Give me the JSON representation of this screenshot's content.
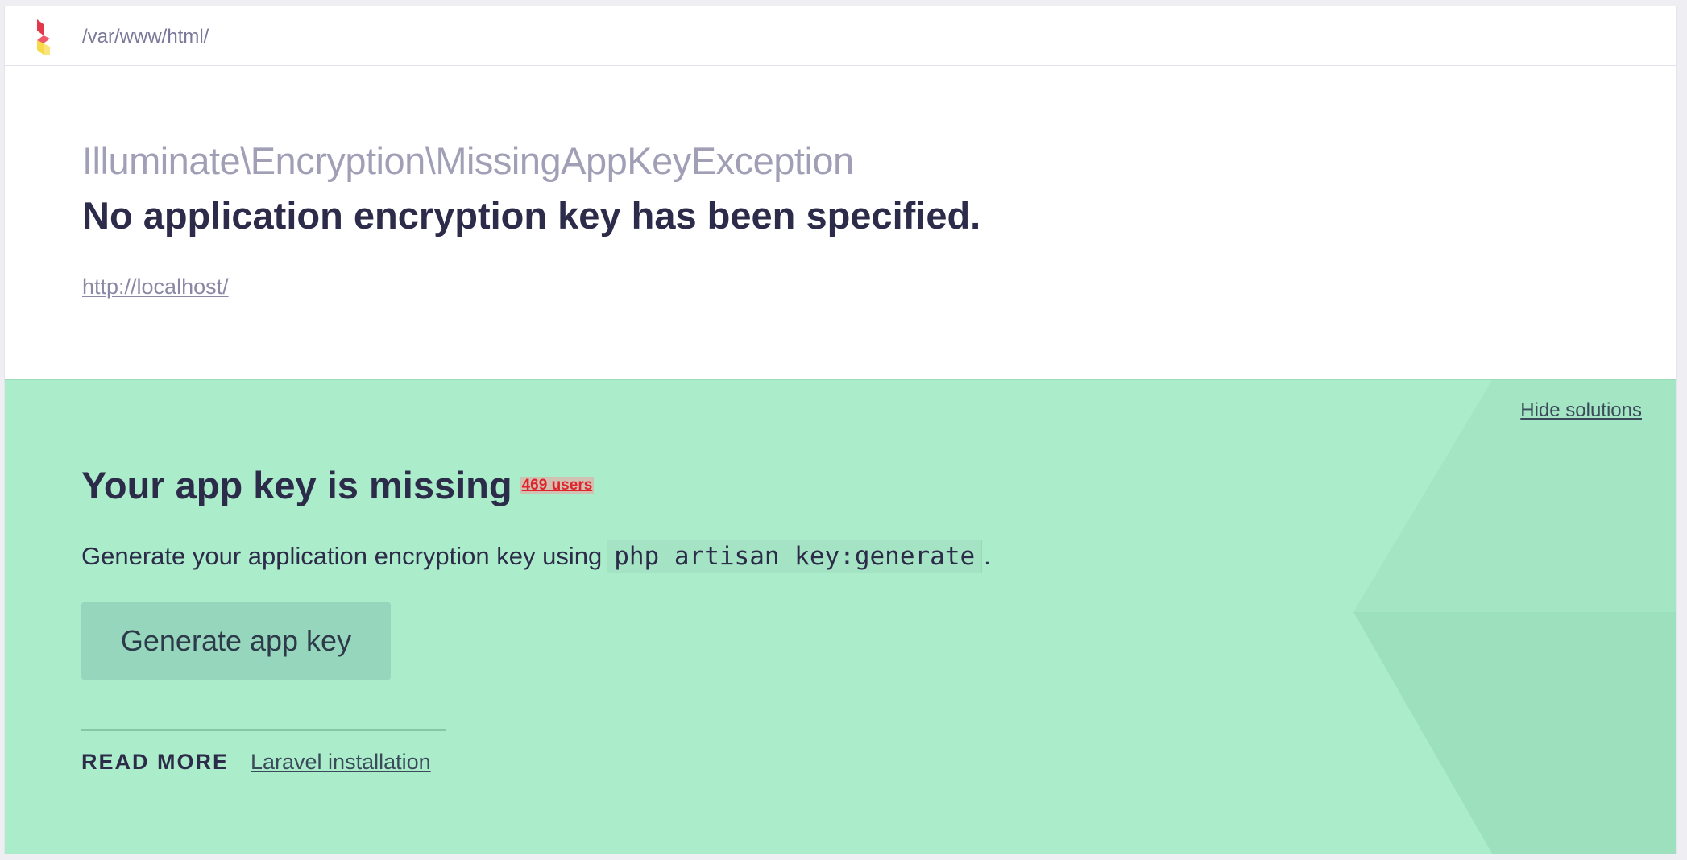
{
  "header": {
    "path": "/var/www/html/",
    "logo_icon": "flare-logo-icon"
  },
  "exception": {
    "class_prefix": "Illuminate\\Encryption\\",
    "class_name": "MissingAppKeyException",
    "message": "No application encryption key has been specified.",
    "url": "http://localhost/"
  },
  "solution": {
    "hide_label": "Hide solutions",
    "title": "Your app key is missing",
    "users_badge": "469 users",
    "description_prefix": "Generate your application encryption key using",
    "command": "php artisan key:generate",
    "description_suffix": ".",
    "button_label": "Generate app key",
    "read_more_label": "READ MORE",
    "links": [
      {
        "label": "Laravel installation"
      }
    ]
  },
  "colors": {
    "solution_bg": "#abedcb",
    "button_bg": "#96d6bc",
    "text_dark": "#2d2b4a",
    "badge_red": "#e0242b"
  }
}
